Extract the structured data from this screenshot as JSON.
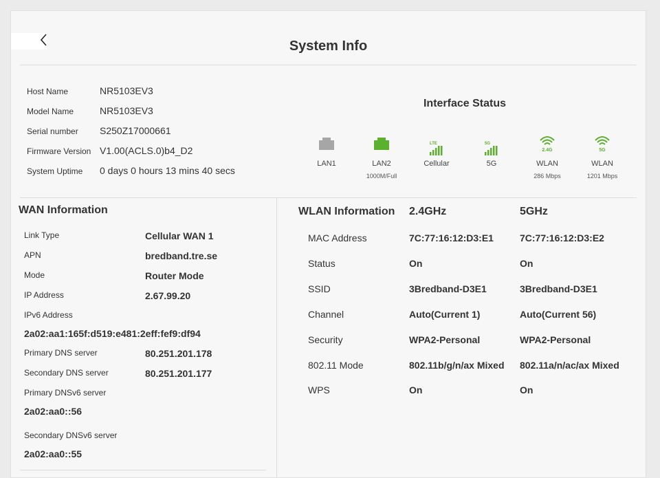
{
  "page": {
    "title": "System Info"
  },
  "basic_info": [
    {
      "label": "Host Name",
      "value": "NR5103EV3"
    },
    {
      "label": "Model Name",
      "value": "NR5103EV3"
    },
    {
      "label": "Serial number",
      "value": "S250Z17000661"
    },
    {
      "label": "Firmware Version",
      "value": "V1.00(ACLS.0)b4_D2"
    },
    {
      "label": "System Uptime",
      "value": "0 days 0 hours 13 mins 40 secs"
    }
  ],
  "interface_status": {
    "title": "Interface Status",
    "items": [
      {
        "icon": "ethernet-port-icon",
        "label": "LAN1",
        "sub": "",
        "active": false,
        "color": "#a6a6a6"
      },
      {
        "icon": "ethernet-port-icon",
        "label": "LAN2",
        "sub": "1000M/Full",
        "active": true,
        "color": "#5bb02d"
      },
      {
        "icon": "signal-bars-icon",
        "badge": "LTE",
        "label": "Cellular",
        "sub": "",
        "active": true,
        "color": "#5bb02d"
      },
      {
        "icon": "signal-bars-icon",
        "badge": "5G",
        "label": "5G",
        "sub": "",
        "active": true,
        "color": "#5bb02d"
      },
      {
        "icon": "wifi-icon",
        "badge": "2.4G",
        "label": "WLAN",
        "sub": "286 Mbps",
        "active": true,
        "color": "#5bb02d"
      },
      {
        "icon": "wifi-icon",
        "badge": "5G",
        "label": "WLAN",
        "sub": "1201 Mbps",
        "active": true,
        "color": "#5bb02d"
      }
    ]
  },
  "wan": {
    "title": "WAN Information",
    "link_type": {
      "label": "Link Type",
      "value": "Cellular WAN 1"
    },
    "apn": {
      "label": "APN",
      "value": "bredband.tre.se"
    },
    "mode": {
      "label": "Mode",
      "value": "Router Mode"
    },
    "ip_address": {
      "label": "IP Address",
      "value": "2.67.99.20"
    },
    "ipv6_address": {
      "label": "IPv6 Address",
      "value": "2a02:aa1:165f:d519:e481:2eff:fef9:df94"
    },
    "primary_dns": {
      "label": "Primary DNS server",
      "value": "80.251.201.178"
    },
    "secondary_dns": {
      "label": "Secondary DNS server",
      "value": "80.251.201.177"
    },
    "primary_dnsv6": {
      "label": "Primary DNSv6 server",
      "value": "2a02:aa0::56"
    },
    "secondary_dnsv6": {
      "label": "Secondary DNSv6 server",
      "value": "2a02:aa0::55"
    }
  },
  "wlan": {
    "title": "WLAN Information",
    "band_24": "2.4GHz",
    "band_5": "5GHz",
    "rows": [
      {
        "label": "MAC Address",
        "v24": "7C:77:16:12:D3:E1",
        "v5": "7C:77:16:12:D3:E2"
      },
      {
        "label": "Status",
        "v24": "On",
        "v5": "On"
      },
      {
        "label": "SSID",
        "v24": "3Bredband-D3E1",
        "v5": "3Bredband-D3E1"
      },
      {
        "label": "Channel",
        "v24": "Auto(Current 1)",
        "v5": "Auto(Current 56)"
      },
      {
        "label": "Security",
        "v24": "WPA2-Personal",
        "v5": "WPA2-Personal"
      },
      {
        "label": "802.11 Mode",
        "v24": "802.11b/g/n/ax Mixed",
        "v5": "802.11a/n/ac/ax Mixed"
      },
      {
        "label": "WPS",
        "v24": "On",
        "v5": "On"
      }
    ]
  },
  "colors": {
    "accent_green": "#5bb02d",
    "inactive_gray": "#a6a6a6"
  }
}
